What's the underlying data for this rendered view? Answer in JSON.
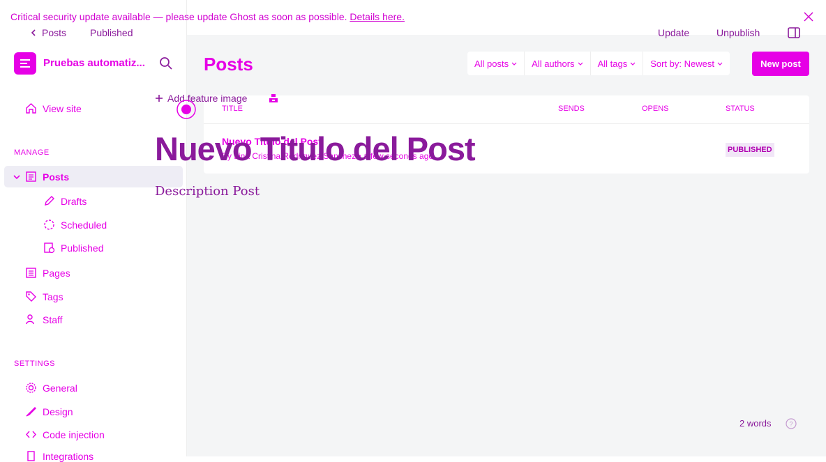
{
  "banner": {
    "text": "Critical security update available — please update Ghost as soon as possible.",
    "link": "Details here."
  },
  "editor": {
    "back": "Posts",
    "status": "Published",
    "update": "Update",
    "unpublish": "Unpublish",
    "feature_image": "Add feature image",
    "title": "Nuevo Titulo del Post",
    "description": "Description Post",
    "word_count": "2 words"
  },
  "sidebar": {
    "site_name": "Pruebas automatiz...",
    "view_site": "View site",
    "manage_label": "MANAGE",
    "posts": "Posts",
    "drafts": "Drafts",
    "scheduled": "Scheduled",
    "published": "Published",
    "pages": "Pages",
    "tags": "Tags",
    "staff": "Staff",
    "settings_label": "SETTINGS",
    "general": "General",
    "design": "Design",
    "code_injection": "Code injection",
    "integrations": "Integrations"
  },
  "main": {
    "title": "Posts",
    "filters": [
      "All posts",
      "All authors",
      "All tags",
      "Sort by: Newest"
    ],
    "new_post": "New post",
    "columns": [
      "TITLE",
      "SENDS",
      "OPENS",
      "STATUS"
    ],
    "row": {
      "title": "Nuevo Titulo del Post",
      "meta": "By Lina Cristina Rodriguez Sanchez • a few seconds ago",
      "status": "PUBLISHED"
    }
  },
  "colors": {
    "accent": "#e600e6",
    "editor_text": "#8a1a9b",
    "main_bg": "#f4f5f6"
  }
}
